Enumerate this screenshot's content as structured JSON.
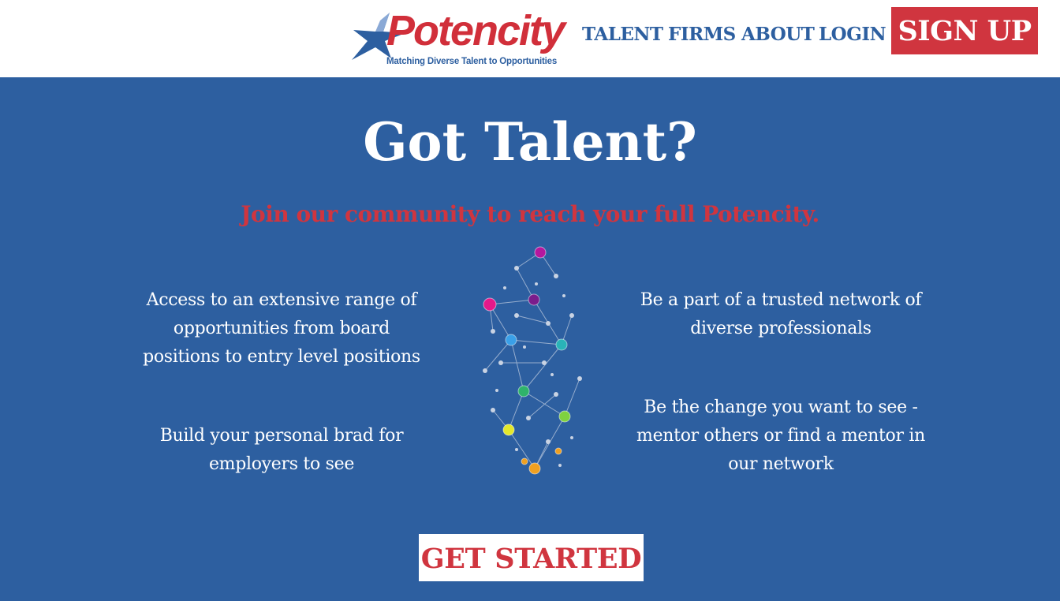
{
  "brand": {
    "name": "Potencity",
    "tagline": "Matching Diverse Talent to Opportunities",
    "red": "#d12f3a",
    "blue": "#2d5fa0"
  },
  "nav": {
    "items": [
      "TALENT",
      "FIRMS",
      "ABOUT",
      "LOGIN"
    ],
    "signup_label": "SIGN UP"
  },
  "hero": {
    "title": "Got Talent?",
    "subtitle": "Join our community to reach your full Potencity.",
    "features": {
      "left_top": "Access to an extensive range of opportunities from board positions to entry level positions",
      "left_bottom": "Build your personal brad for employers to see",
      "right_top": "Be a part of a trusted network of diverse professionals",
      "right_bottom": "Be the change you want to see - mentor others or find a mentor in our network"
    },
    "cta_label": "GET STARTED",
    "illustration": "network-graph-illustration"
  },
  "colors": {
    "background": "#2d5fa0",
    "accent": "#d0353f",
    "text": "#ffffff"
  }
}
